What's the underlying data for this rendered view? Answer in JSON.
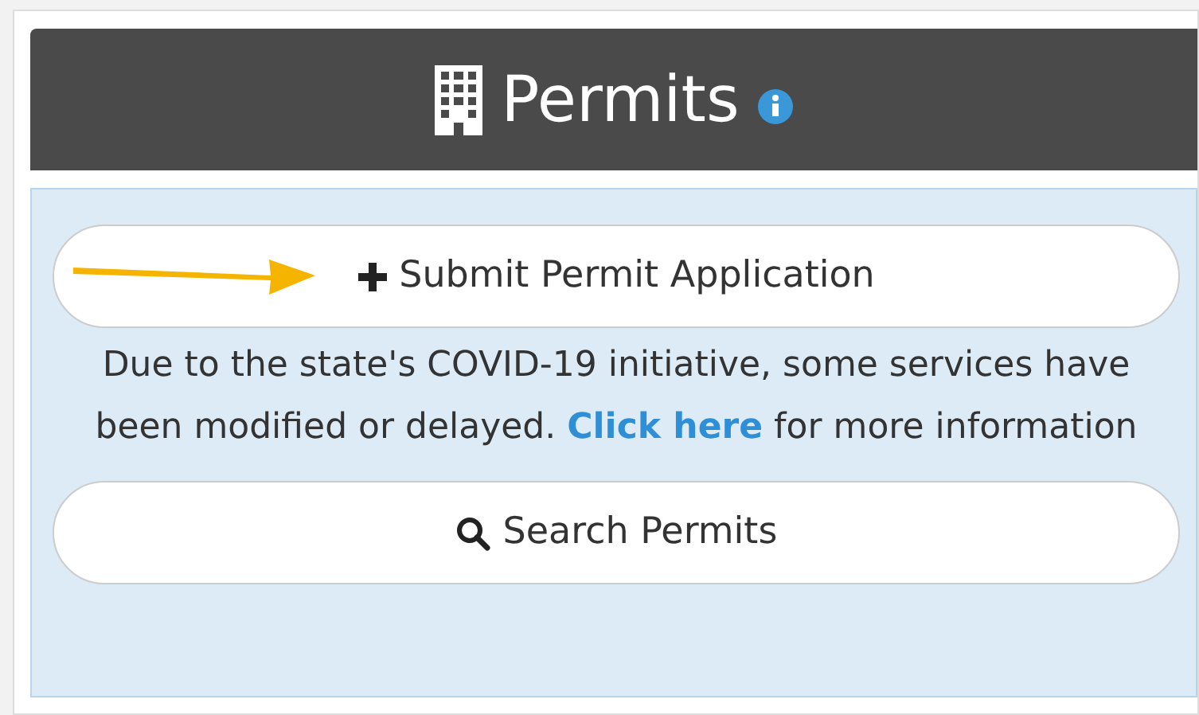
{
  "header": {
    "title": "Permits"
  },
  "submit_button": {
    "label": "Submit Permit Application"
  },
  "notice": {
    "text": "Due to the state's COVID-19 initiative, some services have been modified or delayed.",
    "link": "Click here",
    "text_after": "for more information"
  },
  "search_button": {
    "label": "Search Permits"
  }
}
